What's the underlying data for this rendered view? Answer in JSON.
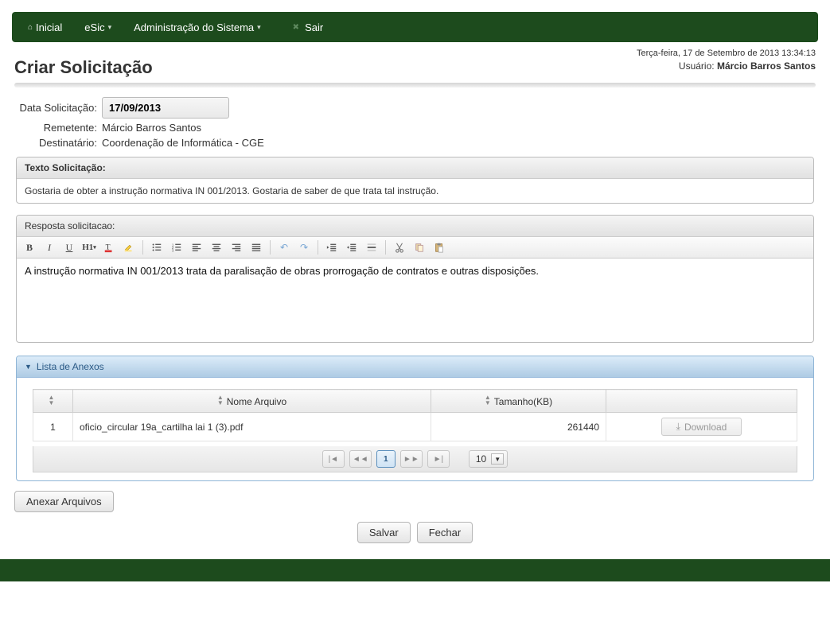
{
  "nav": {
    "home": "Inicial",
    "esic": "eSic",
    "admin": "Administração do Sistema",
    "exit": "Sair"
  },
  "status": {
    "datetime": "Terça-feira, 17 de Setembro de 2013 13:34:13",
    "user_label": "Usuário:",
    "user_name": "Márcio Barros Santos"
  },
  "page_title": "Criar Solicitação",
  "info": {
    "date_label": "Data Solicitação:",
    "date_value": "17/09/2013",
    "sender_label": "Remetente:",
    "sender_value": "Márcio Barros Santos",
    "recipient_label": "Destinatário:",
    "recipient_value": "Coordenação de Informática - CGE"
  },
  "request_text": {
    "header": "Texto Solicitação:",
    "body": "Gostaria de obter a instrução normativa IN 001/2013. Gostaria de saber de que trata tal instrução."
  },
  "response": {
    "header": "Resposta solicitacao:",
    "body": "A instrução normativa IN 001/2013 trata da paralisação de obras prorrogação de contratos e outras disposições."
  },
  "attachments": {
    "header": "Lista de Anexos",
    "columns": {
      "name": "Nome Arquivo",
      "size": "Tamanho(KB)"
    },
    "rows": [
      {
        "idx": "1",
        "name": "oficio_circular 19a_cartilha lai 1 (3).pdf",
        "size": "261440"
      }
    ],
    "download_label": "Download",
    "pager": {
      "current": "1",
      "page_size": "10"
    },
    "attach_button": "Anexar Arquivos"
  },
  "actions": {
    "save": "Salvar",
    "close": "Fechar"
  },
  "toolbar": {
    "bold": "B",
    "italic": "I",
    "underline": "U",
    "heading": "H1"
  }
}
